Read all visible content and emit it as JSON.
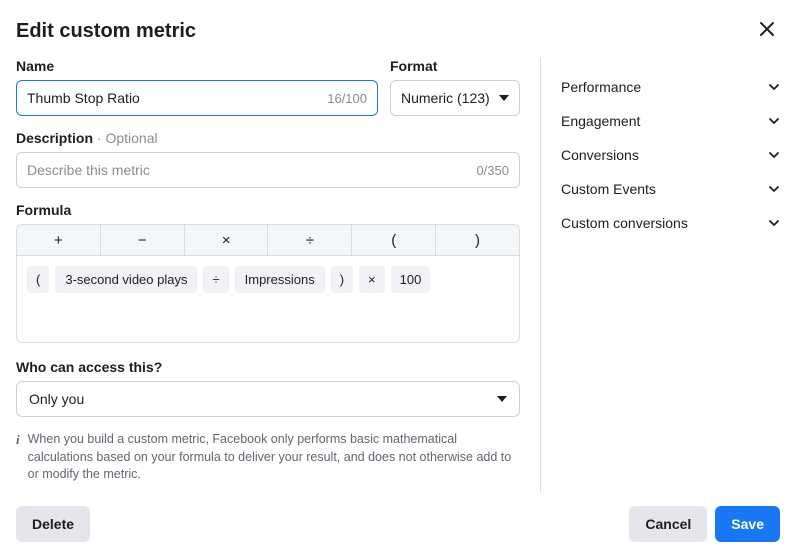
{
  "header": {
    "title": "Edit custom metric"
  },
  "name": {
    "label": "Name",
    "value": "Thumb Stop Ratio",
    "counter": "16/100"
  },
  "format": {
    "label": "Format",
    "selected": "Numeric (123)"
  },
  "description": {
    "label": "Description",
    "optional": " · Optional",
    "placeholder": "Describe this metric",
    "counter": "0/350"
  },
  "formula": {
    "label": "Formula",
    "operators": [
      "+",
      "−",
      "×",
      "÷",
      "(",
      ")"
    ],
    "tokens": [
      "(",
      "3-second video plays",
      "÷",
      "Impressions",
      ")",
      "×",
      "100"
    ]
  },
  "access": {
    "label": "Who can access this?",
    "selected": "Only you"
  },
  "info": {
    "text": "When you build a custom metric, Facebook only performs basic mathematical calculations based on your formula to deliver your result, and does not otherwise add to or modify the metric."
  },
  "categories": [
    "Performance",
    "Engagement",
    "Conversions",
    "Custom Events",
    "Custom conversions"
  ],
  "footer": {
    "delete": "Delete",
    "cancel": "Cancel",
    "save": "Save"
  }
}
